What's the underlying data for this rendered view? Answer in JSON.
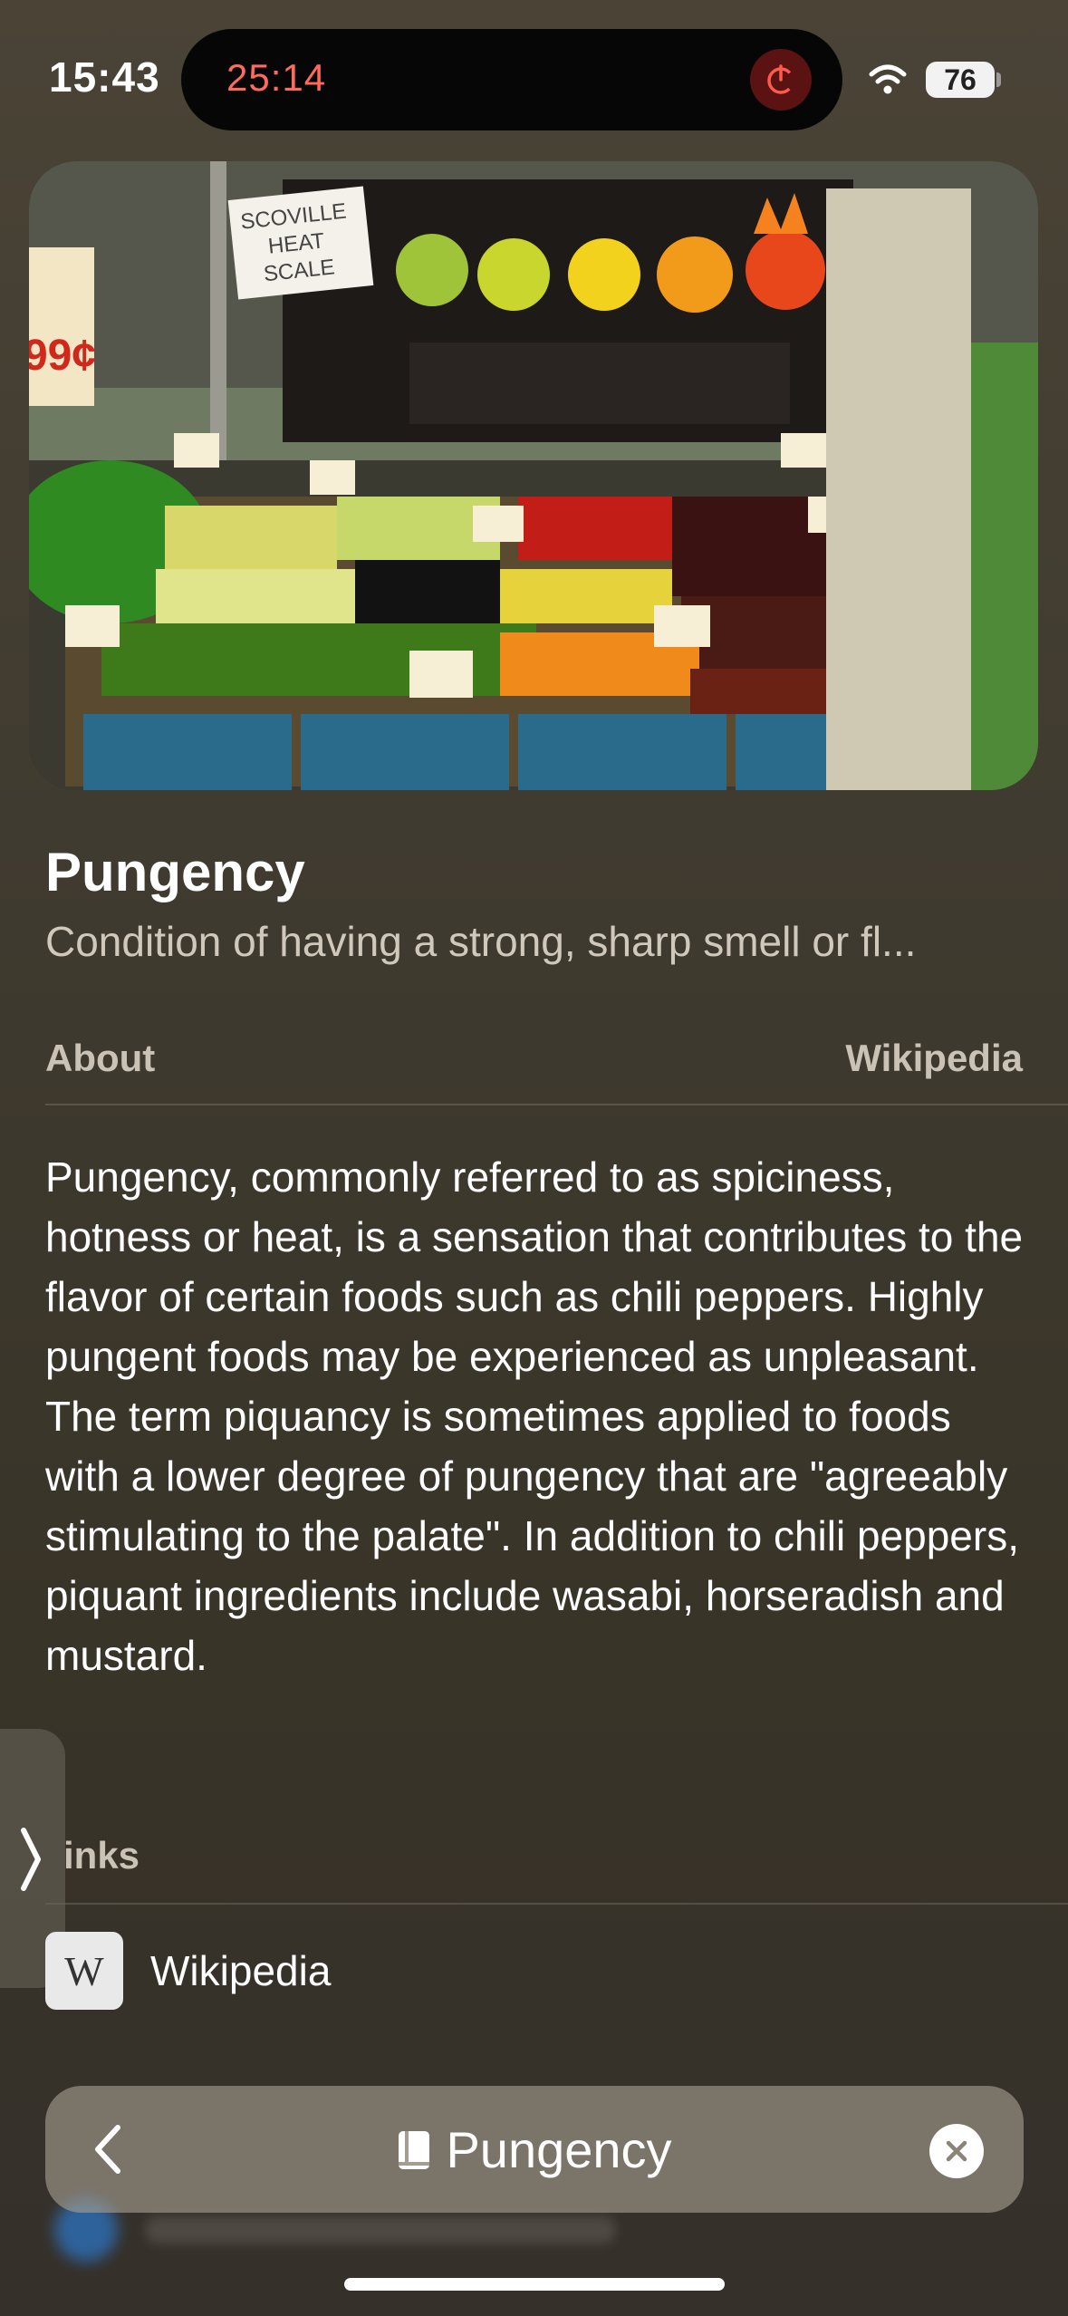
{
  "status_bar": {
    "time": "15:43",
    "battery": "76"
  },
  "dynamic_island": {
    "timer": "25:14"
  },
  "hero": {
    "sign_text": [
      "SCOVILLE",
      "HEAT",
      "SCALE"
    ],
    "price_sign": "99¢"
  },
  "article": {
    "title": "Pungency",
    "subtitle": "Condition of having a strong, sharp smell or fl...",
    "section_label": "About",
    "source_label": "Wikipedia",
    "body": "Pungency, commonly referred to as spiciness, hotness or heat, is a sensation that contributes to the flavor of certain foods such as chili peppers. Highly pungent foods may be experienced as unpleasant. The term piquancy is sometimes applied to foods with a lower degree of pungency that are \"agreeably stimulating to the palate\". In addition to chili peppers, piquant ingredients include wasabi, horseradish and mustard."
  },
  "links": {
    "label": "inks",
    "items": [
      {
        "badge": "W",
        "label": "Wikipedia"
      }
    ]
  },
  "bottom_bar": {
    "title": "Pungency"
  }
}
